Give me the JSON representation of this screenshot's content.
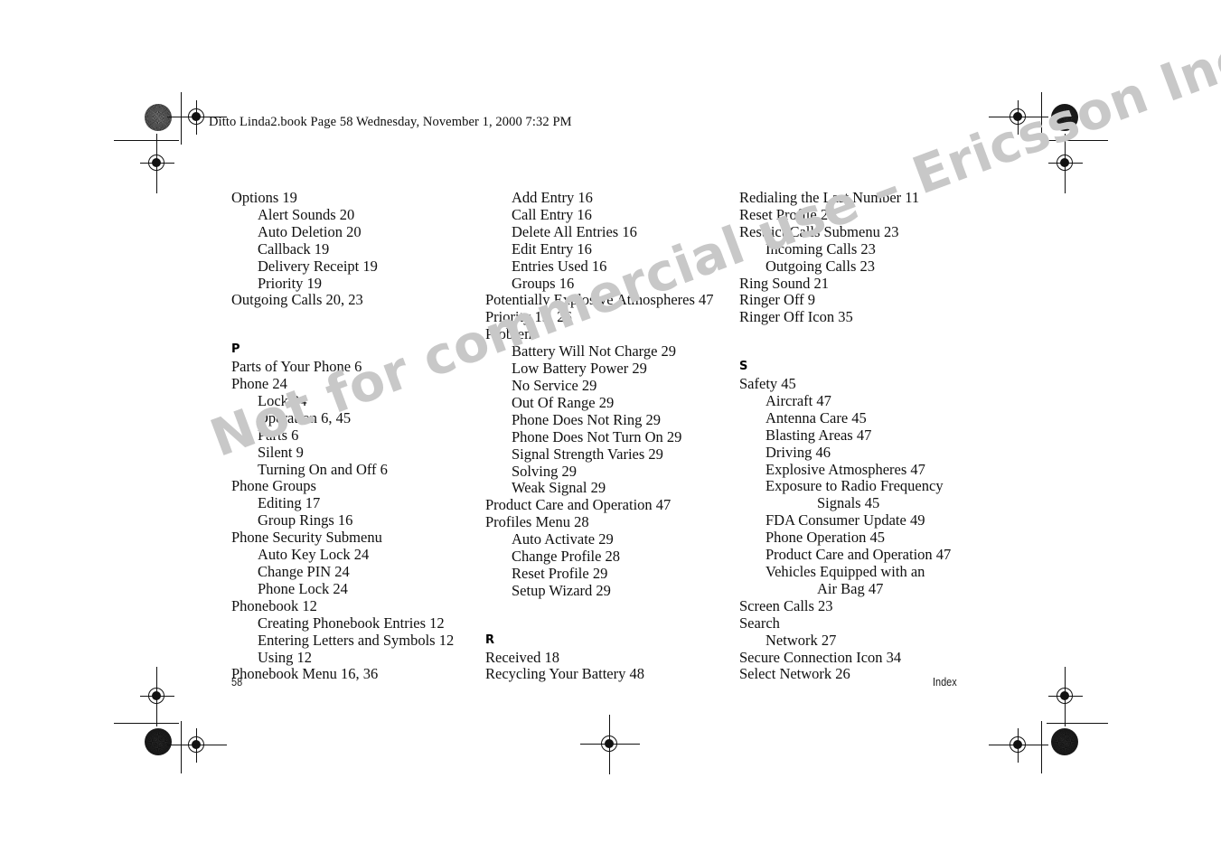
{
  "header": {
    "text": "Ditto Linda2.book  Page 58  Wednesday, November 1, 2000  7:32 PM"
  },
  "watermark": {
    "text": "Not for commercial use – Ericsson Inc.",
    "color": "#c8c8c8"
  },
  "footer": {
    "page_number": "58",
    "section_label": "Index"
  },
  "columns": [
    {
      "id": "column-1",
      "blocks": [
        {
          "type": "entries",
          "items": [
            {
              "text": "Options 19",
              "level": 0
            },
            {
              "text": "Alert Sounds 20",
              "level": 1
            },
            {
              "text": "Auto Deletion 20",
              "level": 1
            },
            {
              "text": "Callback 19",
              "level": 1
            },
            {
              "text": "Delivery Receipt 19",
              "level": 1
            },
            {
              "text": "Priority 19",
              "level": 1
            },
            {
              "text": "Outgoing Calls 20, 23",
              "level": 0
            }
          ]
        },
        {
          "type": "section",
          "letter": "P",
          "items": [
            {
              "text": "Parts of Your Phone 6",
              "level": 0
            },
            {
              "text": "Phone 24",
              "level": 0
            },
            {
              "text": "Lock 24",
              "level": 1
            },
            {
              "text": "Operation 6, 45",
              "level": 1
            },
            {
              "text": "Parts 6",
              "level": 1
            },
            {
              "text": "Silent 9",
              "level": 1
            },
            {
              "text": "Turning On and Off 6",
              "level": 1
            },
            {
              "text": "Phone Groups",
              "level": 0
            },
            {
              "text": "Editing 17",
              "level": 1
            },
            {
              "text": "Group Rings 16",
              "level": 1
            },
            {
              "text": "Phone Security Submenu",
              "level": 0
            },
            {
              "text": "Auto Key Lock 24",
              "level": 1
            },
            {
              "text": "Change PIN 24",
              "level": 1
            },
            {
              "text": "Phone Lock 24",
              "level": 1
            },
            {
              "text": "Phonebook 12",
              "level": 0
            },
            {
              "text": "Creating Phonebook Entries 12",
              "level": 1
            },
            {
              "text": "Entering Letters and Symbols 12",
              "level": 1
            },
            {
              "text": "Using 12",
              "level": 1
            },
            {
              "text": "Phonebook Menu 16, 36",
              "level": 0
            }
          ]
        }
      ]
    },
    {
      "id": "column-2",
      "blocks": [
        {
          "type": "entries",
          "items": [
            {
              "text": "Add Entry 16",
              "level": 1
            },
            {
              "text": "Call Entry 16",
              "level": 1
            },
            {
              "text": "Delete All Entries 16",
              "level": 1
            },
            {
              "text": "Edit Entry 16",
              "level": 1
            },
            {
              "text": "Entries Used 16",
              "level": 1
            },
            {
              "text": "Groups 16",
              "level": 1
            },
            {
              "text": "Potentially Explosive Atmospheres 47",
              "level": 0
            },
            {
              "text": "Priority 19, 26",
              "level": 0
            },
            {
              "text": "Problem",
              "level": 0
            },
            {
              "text": "Battery Will Not Charge 29",
              "level": 1
            },
            {
              "text": "Low Battery Power 29",
              "level": 1
            },
            {
              "text": "No Service 29",
              "level": 1
            },
            {
              "text": "Out Of Range 29",
              "level": 1
            },
            {
              "text": "Phone Does Not Ring 29",
              "level": 1
            },
            {
              "text": "Phone Does Not Turn On 29",
              "level": 1
            },
            {
              "text": "Signal Strength Varies 29",
              "level": 1
            },
            {
              "text": "Solving 29",
              "level": 1
            },
            {
              "text": "Weak Signal 29",
              "level": 1
            },
            {
              "text": "Product Care and Operation 47",
              "level": 0
            },
            {
              "text": "Profiles Menu 28",
              "level": 0
            },
            {
              "text": "Auto Activate 29",
              "level": 1
            },
            {
              "text": "Change Profile 28",
              "level": 1
            },
            {
              "text": "Reset Profile 29",
              "level": 1
            },
            {
              "text": "Setup Wizard 29",
              "level": 1
            }
          ]
        },
        {
          "type": "section",
          "letter": "R",
          "items": [
            {
              "text": "Received 18",
              "level": 0
            },
            {
              "text": "Recycling Your Battery 48",
              "level": 0
            }
          ]
        }
      ]
    },
    {
      "id": "column-3",
      "blocks": [
        {
          "type": "entries",
          "items": [
            {
              "text": "Redialing the Last Number 11",
              "level": 0
            },
            {
              "text": "Reset Profile 29",
              "level": 0
            },
            {
              "text": "Restrict Calls Submenu 23",
              "level": 0
            },
            {
              "text": "Incoming Calls 23",
              "level": 1
            },
            {
              "text": "Outgoing Calls 23",
              "level": 1
            },
            {
              "text": "Ring Sound 21",
              "level": 0
            },
            {
              "text": "Ringer Off 9",
              "level": 0
            },
            {
              "text": "Ringer Off Icon 35",
              "level": 0
            }
          ]
        },
        {
          "type": "section",
          "letter": "S",
          "items": [
            {
              "text": "Safety 45",
              "level": 0
            },
            {
              "text": "Aircraft 47",
              "level": 1
            },
            {
              "text": "Antenna Care 45",
              "level": 1
            },
            {
              "text": "Blasting Areas 47",
              "level": 1
            },
            {
              "text": "Driving 46",
              "level": 1
            },
            {
              "text": "Explosive Atmospheres 47",
              "level": 1
            },
            {
              "text": "Exposure to Radio Frequency",
              "level": 1
            },
            {
              "text": "Signals 45",
              "level": 2
            },
            {
              "text": "FDA Consumer Update 49",
              "level": 1
            },
            {
              "text": "Phone Operation 45",
              "level": 1
            },
            {
              "text": "Product Care and Operation 47",
              "level": 1
            },
            {
              "text": "Vehicles Equipped with an",
              "level": 1
            },
            {
              "text": "Air Bag 47",
              "level": 2
            },
            {
              "text": "Screen Calls 23",
              "level": 0
            },
            {
              "text": "Search",
              "level": 0
            },
            {
              "text": "Network 27",
              "level": 1
            },
            {
              "text": "Secure Connection Icon 34",
              "level": 0
            },
            {
              "text": "Select Network 26",
              "level": 0
            }
          ]
        }
      ]
    }
  ]
}
